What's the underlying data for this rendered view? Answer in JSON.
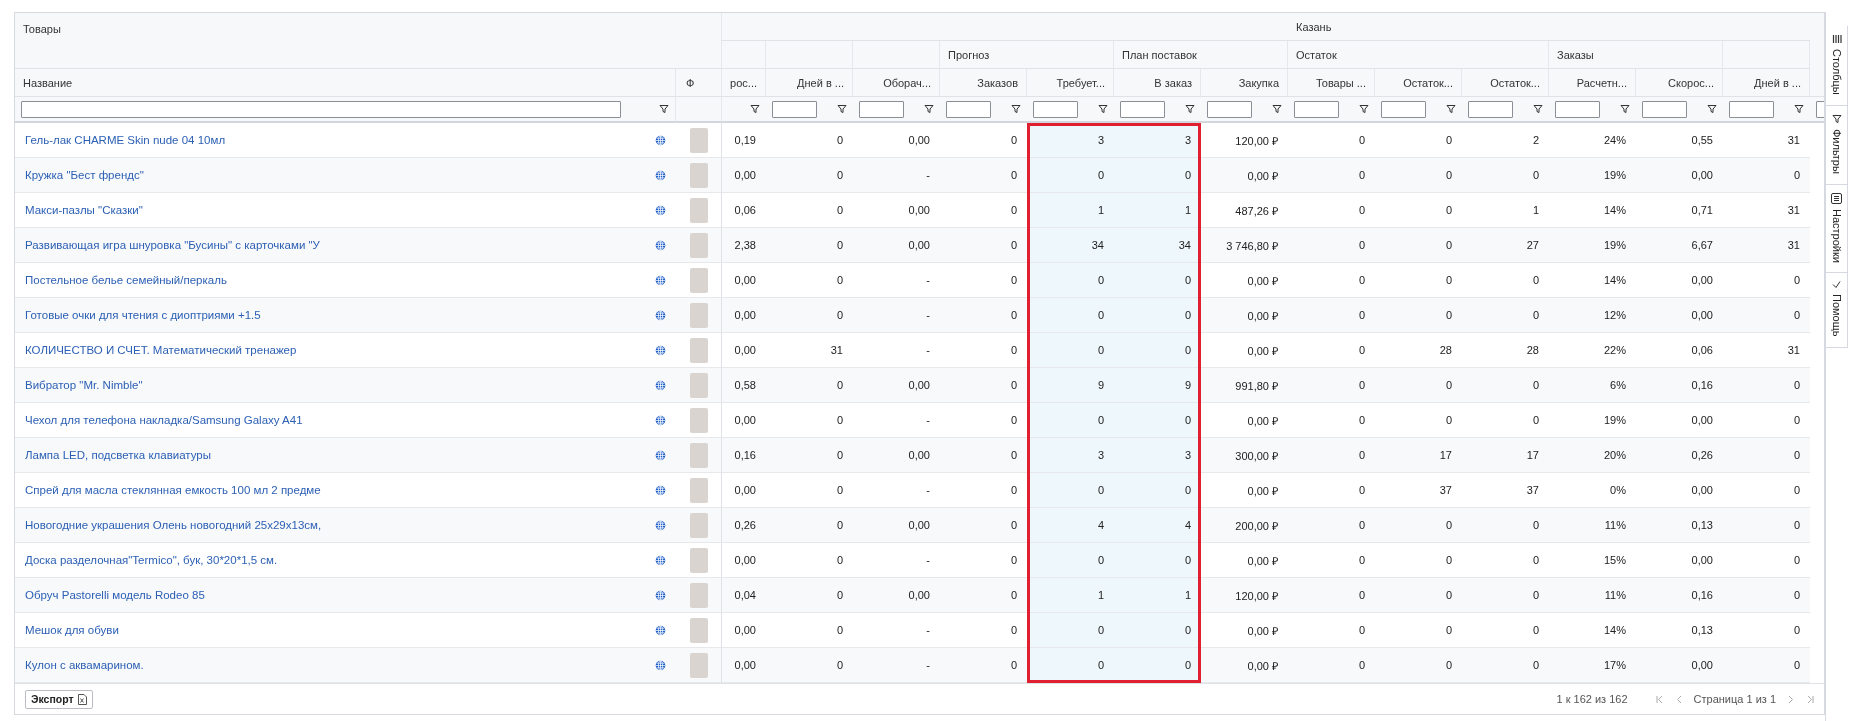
{
  "table": {
    "title": "Товары",
    "name_column": "Название",
    "photo_column": "Ф",
    "column_groups": [
      {
        "subgroups": [
          {
            "columns": [
              {
                "label": "рос...",
                "highlighted": false
              }
            ]
          }
        ]
      },
      {
        "subgroups": [
          {
            "columns": [
              {
                "label": "Дней в ...",
                "highlighted": false
              }
            ]
          }
        ]
      },
      {
        "subgroups": [
          {
            "columns": [
              {
                "label": "Оборач...",
                "highlighted": false
              }
            ]
          }
        ]
      },
      {
        "subgroups": [
          {
            "label": "Прогноз",
            "columns": [
              {
                "label": "Заказов",
                "highlighted": false
              },
              {
                "label": "Требует...",
                "highlighted": true
              }
            ]
          },
          {
            "label": "План поставок",
            "columns": [
              {
                "label": "В заказ",
                "highlighted": true
              },
              {
                "label": "Закупка",
                "highlighted": false
              }
            ]
          }
        ]
      },
      {
        "label": "Казань",
        "subgroups": [
          {
            "label": "Остаток",
            "columns": [
              {
                "label": "Товары ...",
                "highlighted": false
              },
              {
                "label": "Остаток...",
                "highlighted": false
              },
              {
                "label": "Остаток...",
                "highlighted": false
              }
            ]
          },
          {
            "label": "Заказы",
            "columns": [
              {
                "label": "Расчетн...",
                "highlighted": false
              },
              {
                "label": "Скорос...",
                "highlighted": false
              }
            ]
          }
        ]
      },
      {
        "subgroups": [
          {
            "columns": [
              {
                "label": "Дней в ...",
                "highlighted": false
              }
            ]
          }
        ]
      }
    ],
    "rows": [
      {
        "name": "Гель-лак CHARME Skin nude 04 10мл",
        "values": [
          "0,19",
          "0",
          "0,00",
          "0",
          "3",
          "3",
          "120,00 ₽",
          "0",
          "0",
          "2",
          "24%",
          "0,55",
          "31"
        ]
      },
      {
        "name": "Кружка \"Бест френдс\"",
        "values": [
          "0,00",
          "0",
          "-",
          "0",
          "0",
          "0",
          "0,00 ₽",
          "0",
          "0",
          "0",
          "19%",
          "0,00",
          "0"
        ]
      },
      {
        "name": "Макси-пазлы \"Сказки\"",
        "values": [
          "0,06",
          "0",
          "0,00",
          "0",
          "1",
          "1",
          "487,26 ₽",
          "0",
          "0",
          "1",
          "14%",
          "0,71",
          "31"
        ]
      },
      {
        "name": "Развивающая игра шнуровка \"Бусины\" с карточками \"У",
        "values": [
          "2,38",
          "0",
          "0,00",
          "0",
          "34",
          "34",
          "3 746,80 ₽",
          "0",
          "0",
          "27",
          "19%",
          "6,67",
          "31"
        ]
      },
      {
        "name": "Постельное белье семейный/перкаль",
        "values": [
          "0,00",
          "0",
          "-",
          "0",
          "0",
          "0",
          "0,00 ₽",
          "0",
          "0",
          "0",
          "14%",
          "0,00",
          "0"
        ]
      },
      {
        "name": "Готовые очки для чтения с диоптриями +1.5",
        "values": [
          "0,00",
          "0",
          "-",
          "0",
          "0",
          "0",
          "0,00 ₽",
          "0",
          "0",
          "0",
          "12%",
          "0,00",
          "0"
        ]
      },
      {
        "name": "КОЛИЧЕСТВО И СЧЕТ. Математический тренажер",
        "values": [
          "0,00",
          "31",
          "-",
          "0",
          "0",
          "0",
          "0,00 ₽",
          "0",
          "28",
          "28",
          "22%",
          "0,06",
          "31"
        ]
      },
      {
        "name": "Вибратор \"Mr. Nimble\"",
        "values": [
          "0,58",
          "0",
          "0,00",
          "0",
          "9",
          "9",
          "991,80 ₽",
          "0",
          "0",
          "0",
          "6%",
          "0,16",
          "0"
        ]
      },
      {
        "name": "Чехол для телефона накладка/Samsung Galaxy A41",
        "values": [
          "0,00",
          "0",
          "-",
          "0",
          "0",
          "0",
          "0,00 ₽",
          "0",
          "0",
          "0",
          "19%",
          "0,00",
          "0"
        ]
      },
      {
        "name": "Лампа LED, подсветка клавиатуры",
        "values": [
          "0,16",
          "0",
          "0,00",
          "0",
          "3",
          "3",
          "300,00 ₽",
          "0",
          "17",
          "17",
          "20%",
          "0,26",
          "0"
        ]
      },
      {
        "name": "Спрей для масла стеклянная емкость 100 мл 2 предме",
        "values": [
          "0,00",
          "0",
          "-",
          "0",
          "0",
          "0",
          "0,00 ₽",
          "0",
          "37",
          "37",
          "0%",
          "0,00",
          "0"
        ]
      },
      {
        "name": "Новогодние украшения Олень новогодний 25x29x13см,",
        "values": [
          "0,26",
          "0",
          "0,00",
          "0",
          "4",
          "4",
          "200,00 ₽",
          "0",
          "0",
          "0",
          "11%",
          "0,13",
          "0"
        ]
      },
      {
        "name": "Доска разделочная\"Termico\", бук, 30*20*1,5 см.",
        "values": [
          "0,00",
          "0",
          "-",
          "0",
          "0",
          "0",
          "0,00 ₽",
          "0",
          "0",
          "0",
          "15%",
          "0,00",
          "0"
        ]
      },
      {
        "name": "Обруч Pastorelli модель Rodeo 85",
        "values": [
          "0,04",
          "0",
          "0,00",
          "0",
          "1",
          "1",
          "120,00 ₽",
          "0",
          "0",
          "0",
          "11%",
          "0,16",
          "0"
        ]
      },
      {
        "name": "Мешок для обуви",
        "values": [
          "0,00",
          "0",
          "-",
          "0",
          "0",
          "0",
          "0,00 ₽",
          "0",
          "0",
          "0",
          "14%",
          "0,13",
          "0"
        ]
      },
      {
        "name": "Кулон с аквамарином.",
        "values": [
          "0,00",
          "0",
          "-",
          "0",
          "0",
          "0",
          "0,00 ₽",
          "0",
          "0",
          "0",
          "17%",
          "0,00",
          "0"
        ]
      }
    ]
  },
  "footer": {
    "export": "Экспорт",
    "range": "1 к 162 из 162",
    "page": "Страница 1 из 1"
  },
  "side_tabs": [
    {
      "label": "Столбцы",
      "kind": "columns"
    },
    {
      "label": "Фильтры",
      "kind": "filters"
    },
    {
      "label": "Настройки",
      "kind": "settings"
    },
    {
      "label": "Помощь",
      "kind": "help"
    }
  ]
}
